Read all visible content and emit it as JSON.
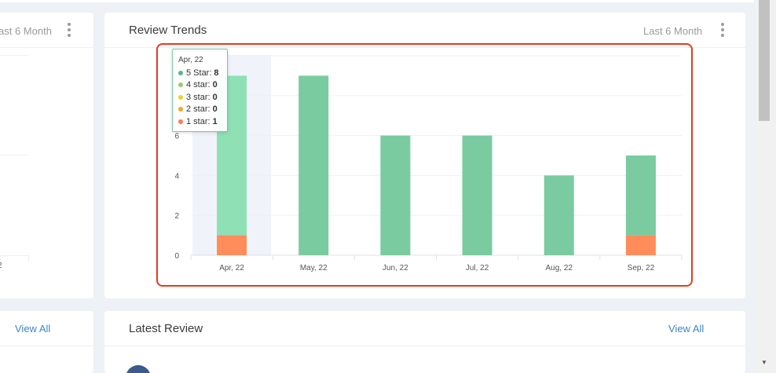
{
  "left_card": {
    "filter_label": "ast 6 Month",
    "axis_fragment": "2",
    "view_all": "View All"
  },
  "review_trends": {
    "title": "Review Trends",
    "filter_label": "Last 6 Month"
  },
  "latest_review": {
    "title": "Latest Review",
    "view_all": "View All"
  },
  "tooltip": {
    "title": "Apr, 22",
    "rows": [
      {
        "label": "5 Star:",
        "value": "8",
        "color": "#59b889"
      },
      {
        "label": "4 star:",
        "value": "0",
        "color": "#8fd16d"
      },
      {
        "label": "3 star:",
        "value": "0",
        "color": "#f2d21b"
      },
      {
        "label": "2 star:",
        "value": "0",
        "color": "#f5a623"
      },
      {
        "label": "1 star:",
        "value": "1",
        "color": "#ff7b54"
      }
    ]
  },
  "chart_data": {
    "type": "bar",
    "stacked": true,
    "categories": [
      "Apr, 22",
      "May, 22",
      "Jun, 22",
      "Jul, 22",
      "Aug, 22",
      "Sep, 22"
    ],
    "series": [
      {
        "name": "5 Star",
        "values": [
          8,
          9,
          6,
          6,
          4,
          4
        ],
        "color": "#7acba0"
      },
      {
        "name": "4 star",
        "values": [
          0,
          0,
          0,
          0,
          0,
          0
        ],
        "color": "#8fd16d"
      },
      {
        "name": "3 star",
        "values": [
          0,
          0,
          0,
          0,
          0,
          0
        ],
        "color": "#f2d21b"
      },
      {
        "name": "2 star",
        "values": [
          0,
          0,
          0,
          0,
          0,
          0
        ],
        "color": "#f5a623"
      },
      {
        "name": "1 star",
        "values": [
          1,
          0,
          0,
          0,
          0,
          1
        ],
        "color": "#ff8c5a"
      }
    ],
    "y_ticks": [
      0,
      2,
      4,
      6
    ],
    "ylim": [
      0,
      10
    ],
    "grid": true,
    "hovered_category": "Apr, 22",
    "hover_color_5star": "#8fe0b5",
    "hover_band_color": "#f0f4fa"
  }
}
